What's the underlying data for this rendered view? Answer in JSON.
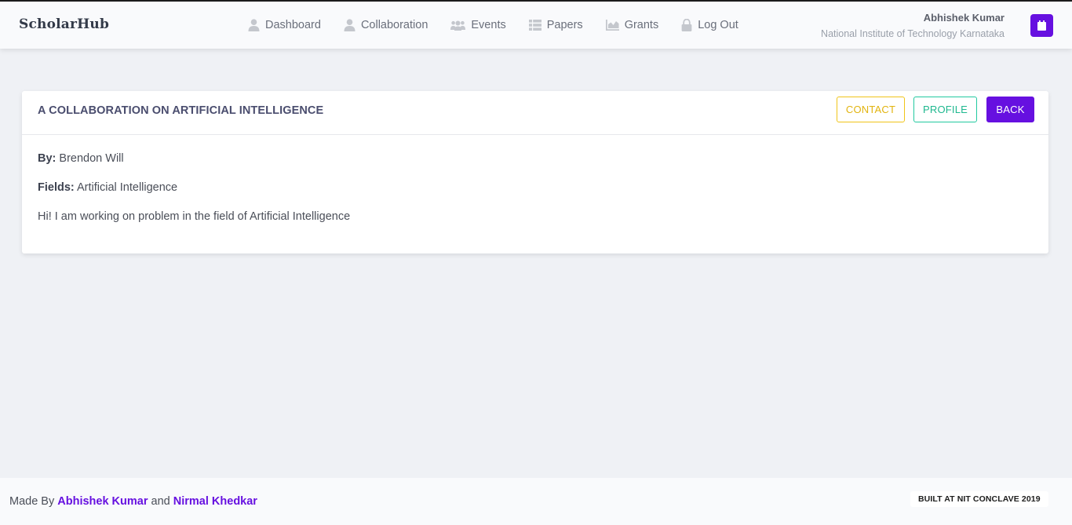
{
  "brand": "ScholarHub",
  "nav": [
    {
      "label": "Dashboard",
      "icon": "user-icon"
    },
    {
      "label": "Collaboration",
      "icon": "user-icon"
    },
    {
      "label": "Events",
      "icon": "users-icon"
    },
    {
      "label": "Papers",
      "icon": "list-icon"
    },
    {
      "label": "Grants",
      "icon": "chart-icon"
    },
    {
      "label": "Log Out",
      "icon": "lock-icon"
    }
  ],
  "user": {
    "name": "Abhishek Kumar",
    "institute": "National Institute of Technology Karnataka"
  },
  "card": {
    "title": "A COLLABORATION ON ARTIFICIAL INTELLIGENCE",
    "buttons": {
      "contact": "CONTACT",
      "profile": "PROFILE",
      "back": "BACK"
    },
    "by_label": "By:",
    "by_value": "Brendon Will",
    "fields_label": "Fields:",
    "fields_value": "Artificial Intelligence",
    "description": "Hi! I am working on problem in the field of Artificial Intelligence"
  },
  "footer": {
    "made_by": "Made By",
    "author1": "Abhishek Kumar",
    "and": "and",
    "author2": "Nirmal Khedkar",
    "badge": "BUILT AT NIT CONCLAVE 2019"
  },
  "colors": {
    "accent": "#6610e0",
    "contact": "#f0c419",
    "profile": "#22c9a0",
    "icon": "#c4c7cd"
  }
}
